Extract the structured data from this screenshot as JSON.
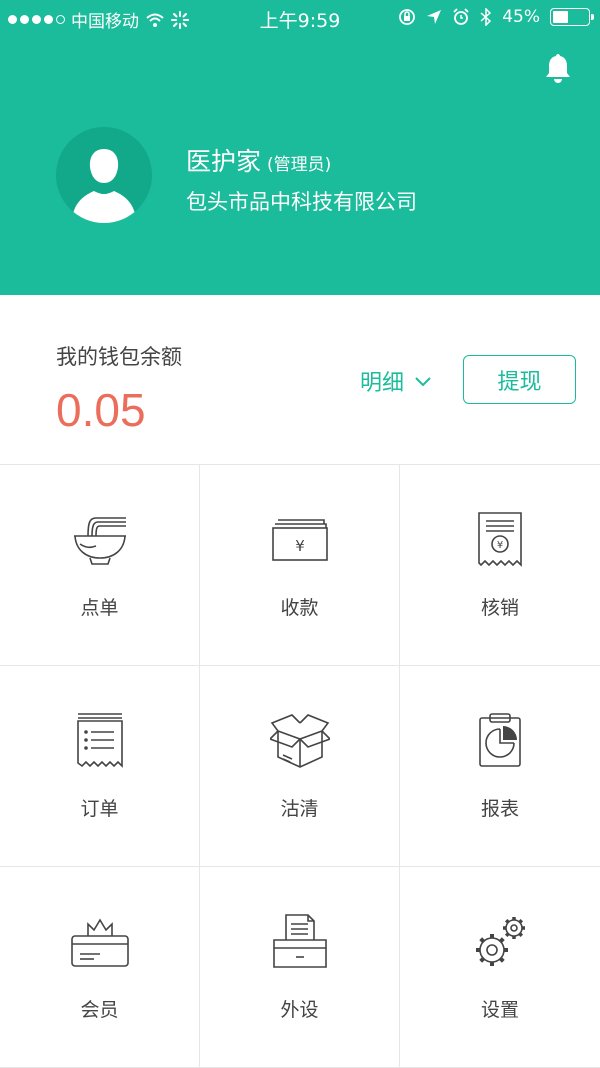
{
  "status_bar": {
    "carrier": "中国移动",
    "time": "上午9:59",
    "battery": "45%",
    "battery_level": 0.45
  },
  "profile": {
    "name": "医护家",
    "role": "(管理员)",
    "company": "包头市品中科技有限公司"
  },
  "wallet": {
    "label": "我的钱包余额",
    "amount": "0.05",
    "detail_label": "明细",
    "withdraw_label": "提现"
  },
  "menu": {
    "items": [
      {
        "label": "点单",
        "icon": "noodle-bowl-icon"
      },
      {
        "label": "收款",
        "icon": "cash-icon"
      },
      {
        "label": "核销",
        "icon": "receipt-icon"
      },
      {
        "label": "订单",
        "icon": "order-list-icon"
      },
      {
        "label": "沽清",
        "icon": "box-icon"
      },
      {
        "label": "报表",
        "icon": "report-chart-icon"
      },
      {
        "label": "会员",
        "icon": "member-card-icon"
      },
      {
        "label": "外设",
        "icon": "printer-icon"
      },
      {
        "label": "设置",
        "icon": "gears-icon"
      }
    ]
  },
  "colors": {
    "primary": "#1bbc9b",
    "amount": "#ea6e5b"
  }
}
